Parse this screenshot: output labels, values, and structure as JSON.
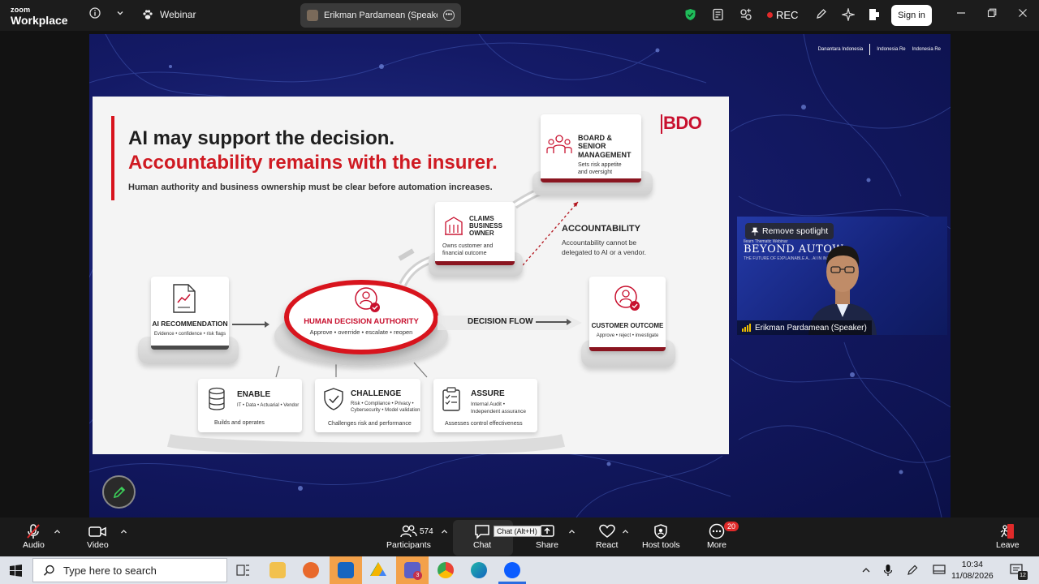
{
  "titlebar": {
    "brand_small": "zoom",
    "brand_large": "Workplace",
    "webinar_label": "Webinar",
    "speaker_tab": "Erikman Pardamean (Speaker)'s sc",
    "rec_label": "REC",
    "signin_label": "Sign in"
  },
  "share": {
    "logos": [
      "Danantara Indonesia",
      "Indonesia Re",
      "Indonesia Re"
    ],
    "slide": {
      "heading_line1": "AI may support the decision.",
      "heading_line2": "Accountability remains with the insurer.",
      "subtitle": "Human authority and business ownership must be clear before automation increases.",
      "brand": "BDO",
      "board": {
        "title_1": "BOARD & SENIOR",
        "title_2": "MANAGEMENT",
        "desc_1": "Sets risk appetite",
        "desc_2": "and oversight"
      },
      "claims": {
        "title_1": "CLAIMS",
        "title_2": "BUSINESS",
        "title_3": "OWNER",
        "desc_1": "Owns customer and",
        "desc_2": "financial outcome"
      },
      "accountability": {
        "title": "ACCOUNTABILITY",
        "desc_1": "Accountability cannot be",
        "desc_2": "delegated to AI or a vendor."
      },
      "ai_rec": {
        "title": "AI RECOMMENDATION",
        "desc": "Evidence • confidence • risk flags"
      },
      "hub": {
        "title": "HUMAN DECISION AUTHORITY",
        "desc": "Approve • override • escalate • reopen"
      },
      "decision_flow": "DECISION FLOW",
      "customer": {
        "title": "CUSTOMER OUTCOME",
        "desc": "Approve • reject • investigate"
      },
      "enable": {
        "title": "ENABLE",
        "desc": "IT • Data • Actuarial • Vendor",
        "foot": "Builds and operates"
      },
      "challenge": {
        "title": "CHALLENGE",
        "desc_1": "Risk • Compliance • Privacy •",
        "desc_2": "Cybersecurity • Model validation",
        "foot": "Challenges risk and performance"
      },
      "assure": {
        "title": "ASSURE",
        "desc_1": "Internal Audit •",
        "desc_2": "Independent assurance",
        "foot": "Assesses control effectiveness"
      }
    },
    "thumbnail": {
      "remove_spotlight": "Remove spotlight",
      "banner_small": "Ilearn Thematic Webinar",
      "banner_title": "BEYOND AUTOW",
      "banner_sub": "THE FUTURE OF EXPLAINABLE A... AI IN INSURANCE",
      "speaker_name": "Erikman Pardamean (Speaker)"
    }
  },
  "toolbar": {
    "audio": "Audio",
    "video": "Video",
    "participants": "Participants",
    "participant_count": "574",
    "chat": "Chat",
    "chat_tooltip": "Chat (Alt+H)",
    "share": "Share",
    "react": "React",
    "host_tools": "Host tools",
    "more": "More",
    "more_badge": "20",
    "leave": "Leave"
  },
  "taskbar": {
    "search_placeholder": "Type here to search",
    "time": "10:34",
    "date": "11/08/2026",
    "notif_count": "12",
    "teams_badge": "3"
  },
  "colors": {
    "accent_red": "#d8141d",
    "bdo_red": "#c8102e",
    "rec_red": "#e02a2a",
    "shield_green": "#1fbd5a"
  }
}
